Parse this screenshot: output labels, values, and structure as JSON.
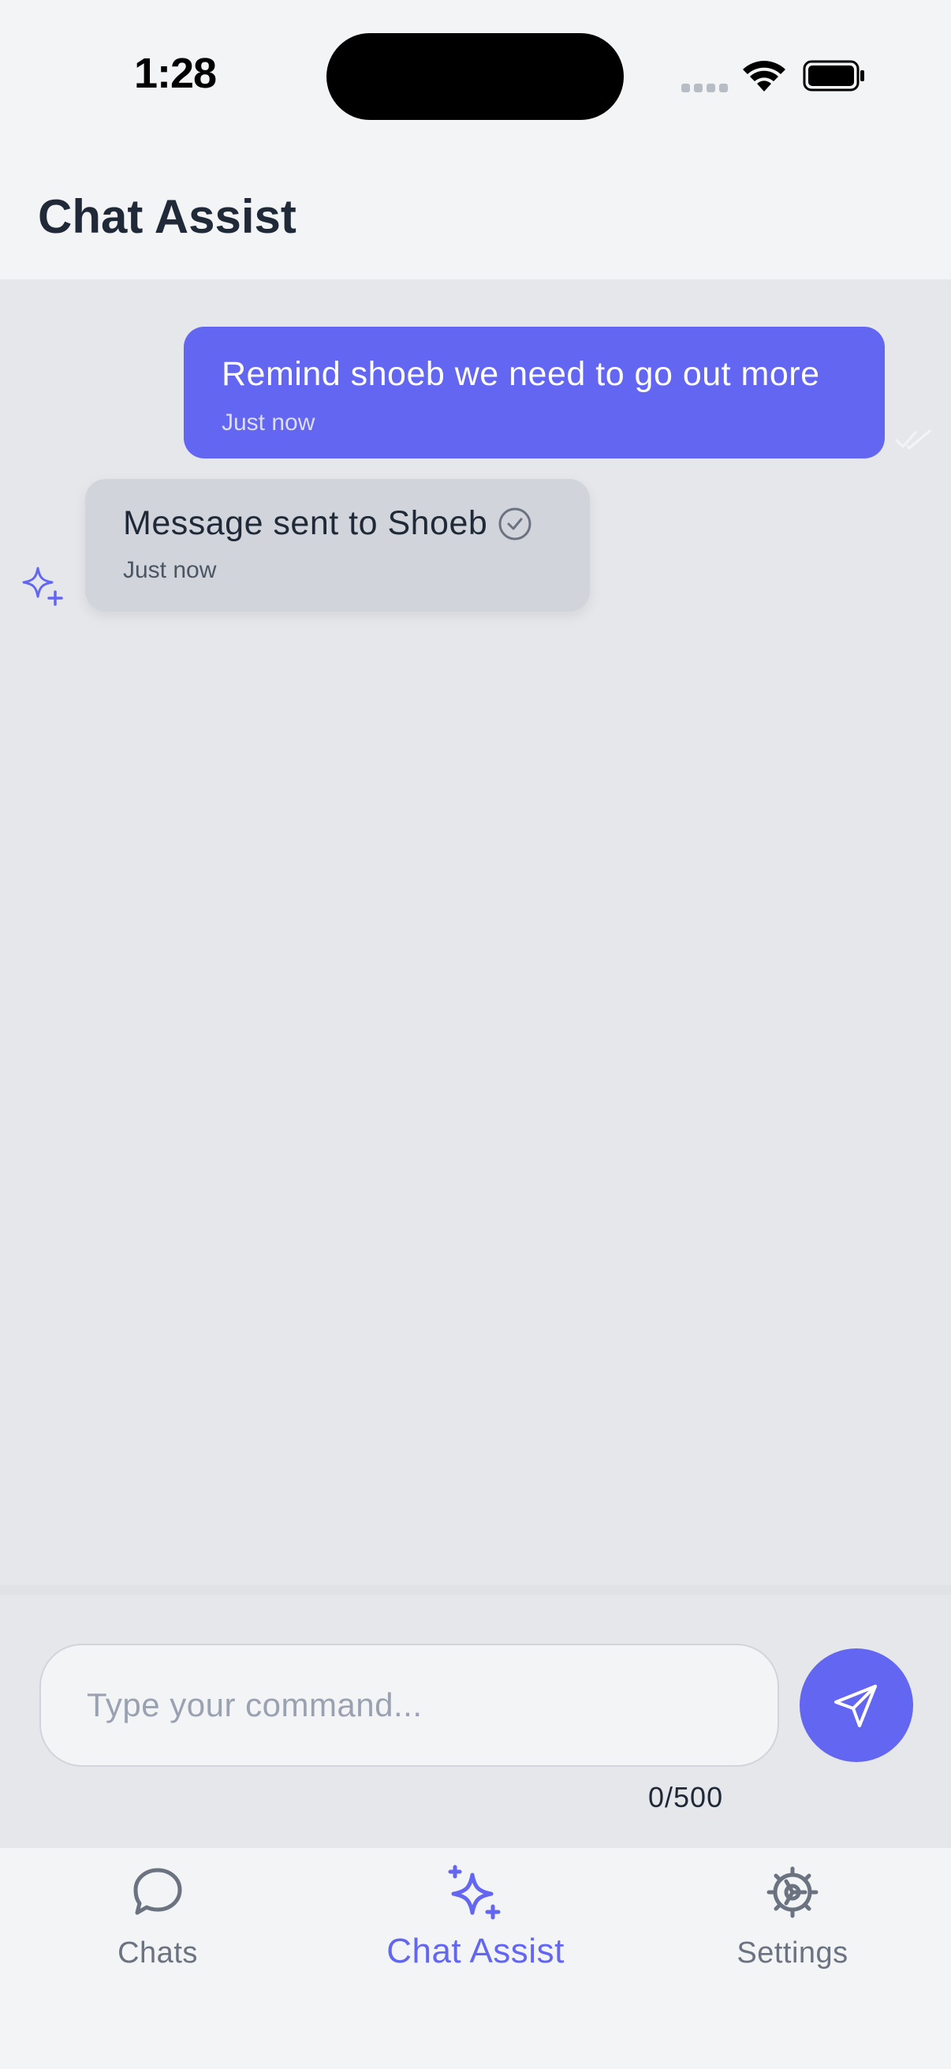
{
  "status_bar": {
    "time": "1:28"
  },
  "header": {
    "title": "Chat Assist"
  },
  "messages": [
    {
      "sender": "user",
      "text": "Remind shoeb we need to go out more",
      "time": "Just now"
    },
    {
      "sender": "assistant",
      "text": "Message sent to Shoeb",
      "time": "Just now"
    }
  ],
  "composer": {
    "placeholder": "Type your command...",
    "value": "",
    "char_count": "0/500"
  },
  "tabs": [
    {
      "label": "Chats",
      "icon": "chat-bubble-icon",
      "active": false
    },
    {
      "label": "Chat Assist",
      "icon": "sparkles-icon",
      "active": true
    },
    {
      "label": "Settings",
      "icon": "gear-icon",
      "active": false
    }
  ],
  "colors": {
    "accent": "#6366f1",
    "user_bubble": "#6366f1",
    "bot_bubble": "#d1d5db",
    "background": "#e5e7eb",
    "text": "#1f2937"
  }
}
